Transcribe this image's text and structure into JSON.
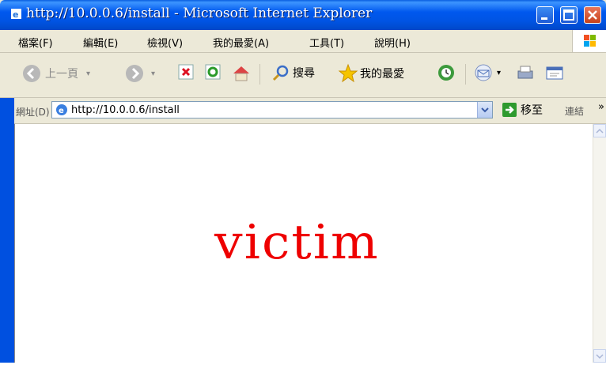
{
  "window": {
    "title": "http://10.0.0.6/install - Microsoft Internet Explorer"
  },
  "menu": [
    "檔案(F)",
    "編輯(E)",
    "檢視(V)",
    "我的最愛(A)",
    "工具(T)",
    "說明(H)"
  ],
  "toolbar": {
    "back_label": "上一頁",
    "search_label": "搜尋",
    "favorites_label": "我的最愛"
  },
  "address": {
    "label": "網址(D)",
    "url": "http://10.0.0.6/install",
    "go_label": "移至",
    "links_label": "連結"
  },
  "page": {
    "text": "victim",
    "text_color": "#EE0000"
  },
  "icons": [
    "ie-icon",
    "minimize-icon",
    "maximize-icon",
    "close-icon",
    "windows-logo-icon",
    "back-icon",
    "forward-icon",
    "stop-icon",
    "refresh-icon",
    "home-icon",
    "search-icon",
    "favorites-star-icon",
    "history-icon",
    "mail-icon",
    "print-icon",
    "edit-icon",
    "go-arrow-icon"
  ],
  "colors": {
    "title_bar": "#0054E3",
    "chrome": "#ECE9D8"
  }
}
